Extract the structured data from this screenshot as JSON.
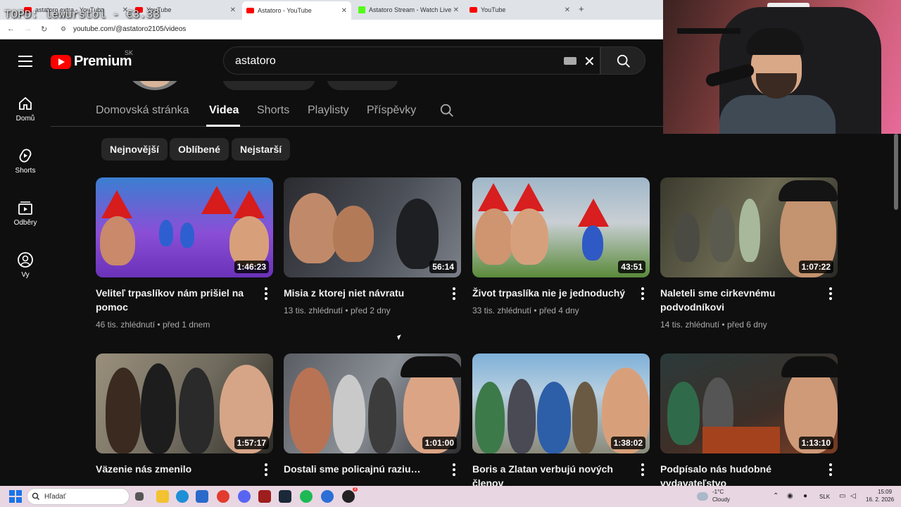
{
  "overlay": {
    "text": "TOPD: lewurstol - €3.33"
  },
  "browser": {
    "tabs": [
      {
        "title": "astatoro extra - YouTube",
        "icon": "youtube-icon"
      },
      {
        "title": "YouTube",
        "icon": "youtube-icon"
      },
      {
        "title": "Astatoro - YouTube",
        "icon": "youtube-icon",
        "active": true
      },
      {
        "title": "Astatoro Stream - Watch Live o",
        "icon": "kick-icon"
      },
      {
        "title": "YouTube",
        "icon": "youtube-icon"
      }
    ],
    "new_tab": "+",
    "url": "youtube.com/@astatoro2105/videos"
  },
  "header": {
    "logo_text": "Premium",
    "country_code": "SK",
    "search_value": "astatoro",
    "clear_symbol": "✕"
  },
  "sidebar": {
    "items": [
      {
        "label": "Domů",
        "icon": "home-icon"
      },
      {
        "label": "Shorts",
        "icon": "shorts-icon"
      },
      {
        "label": "Odběry",
        "icon": "subscriptions-icon"
      },
      {
        "label": "Vy",
        "icon": "account-icon"
      }
    ]
  },
  "channel_tabs": [
    "Domovská stránka",
    "Videa",
    "Shorts",
    "Playlisty",
    "Příspěvky"
  ],
  "active_tab": "Videa",
  "chips": [
    "Nejnovější",
    "Oblíbené",
    "Nejstarší"
  ],
  "videos": [
    {
      "title": "Veliteľ trpaslíkov nám prišiel na pomoc",
      "views": "46 tis. zhlédnutí",
      "age": "před 1 dnem",
      "duration": "1:46:23"
    },
    {
      "title": "Misia z ktorej niet návratu",
      "views": "13 tis. zhlédnutí",
      "age": "před 2 dny",
      "duration": "56:14"
    },
    {
      "title": "Život trpaslíka nie je jednoduchý",
      "views": "33 tis. zhlédnutí",
      "age": "před 4 dny",
      "duration": "43:51"
    },
    {
      "title": "Naleteli sme cirkevnému podvodníkovi",
      "views": "14 tis. zhlédnutí",
      "age": "před 6 dny",
      "duration": "1:07:22"
    },
    {
      "title": "Väzenie nás zmenilo",
      "views": "",
      "age": "",
      "duration": "1:57:17"
    },
    {
      "title": "Dostali sme policajnú raziu…",
      "views": "",
      "age": "",
      "duration": "1:01:00"
    },
    {
      "title": "Boris a Zlatan verbujú nových členov",
      "views": "",
      "age": "",
      "duration": "1:38:02"
    },
    {
      "title": "Podpísalo nás hudobné vydavateľstvo",
      "views": "",
      "age": "",
      "duration": "1:13:10"
    }
  ],
  "taskbar": {
    "search_placeholder": "Hľadať",
    "weather_temp": "-1°C",
    "weather_text": "Cloudy",
    "language": "SLK",
    "time": "15:09",
    "date": "16. 2. 2026",
    "badge_count": "3"
  },
  "colors": {
    "yt_bg": "#0f0f0f",
    "yt_red": "#ff0000",
    "chip_bg": "#272727",
    "taskbar_bg": "#e8d6e3"
  }
}
